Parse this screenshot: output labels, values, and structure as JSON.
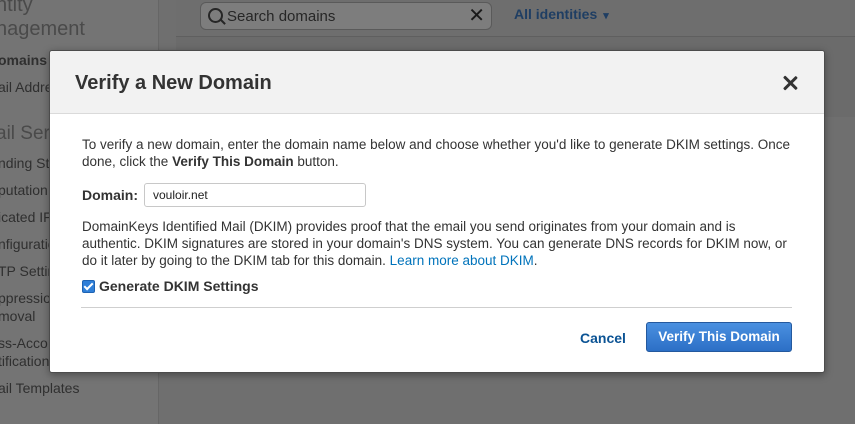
{
  "background": {
    "sidebar": {
      "header_line1": "ntity",
      "header_line2": "nagement",
      "active_item": "omains",
      "items": [
        "ail Addre",
        "ail Serv",
        "nding Sta",
        "putation I",
        "icated IF",
        "nfiguratio",
        "TP Settir",
        "ppression",
        "moval",
        "ss-Acco",
        "tifications",
        "ail Templates"
      ]
    },
    "search": {
      "placeholder": "Search domains",
      "clear_icon": "close-icon"
    },
    "identities_filter": "All identities"
  },
  "modal": {
    "title": "Verify a New Domain",
    "close_icon": "close-icon",
    "intro_text_1": "To verify a new domain, enter the domain name below and choose whether you'd like to generate DKIM settings. Once done, click the ",
    "intro_bold": "Verify This Domain",
    "intro_text_2": " button.",
    "domain_label": "Domain:",
    "domain_value": "vouloir.net",
    "dkim_text": "DomainKeys Identified Mail (DKIM) provides proof that the email you send originates from your domain and is authentic. DKIM signatures are stored in your domain's DNS system. You can generate DNS records for DKIM now, or do it later by going to the DKIM tab for this domain. ",
    "dkim_link": "Learn more about DKIM",
    "dkim_link_suffix": ".",
    "checkbox_label": "Generate DKIM Settings",
    "checkbox_checked": true,
    "cancel_label": "Cancel",
    "verify_label": "Verify This Domain"
  },
  "colors": {
    "primary_button": "#2c6fc6",
    "link": "#0073bb",
    "overlay": "#6f6f6f"
  }
}
